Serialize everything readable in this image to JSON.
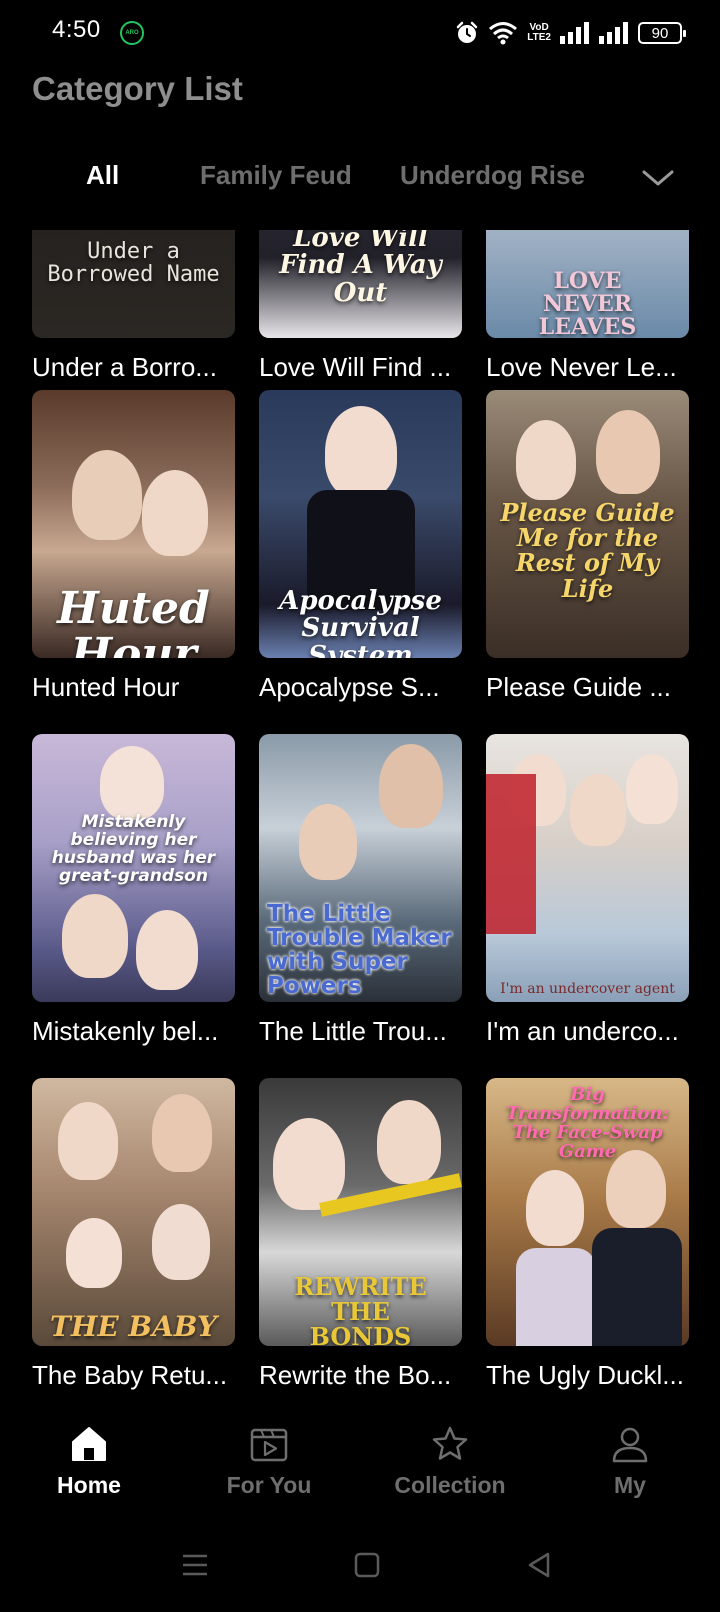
{
  "status_bar": {
    "time": "4:50",
    "aro_badge": "ARO",
    "volte_top": "VoD",
    "volte_bottom": "LTE2",
    "battery": "90"
  },
  "header": {
    "title": "Category List"
  },
  "tabs": [
    {
      "label": "All",
      "active": true
    },
    {
      "label": "Family Feud",
      "active": false
    },
    {
      "label": "Underdog Rise",
      "active": false
    }
  ],
  "dramas": [
    {
      "title": "Under a Borro...",
      "poster_text": "Under a\nBorrowed Name"
    },
    {
      "title": "Love Will Find ...",
      "poster_text": "Love Will Find A Way Out"
    },
    {
      "title": "Love Never Le...",
      "poster_text": "LOVE NEVER LEAVES"
    },
    {
      "title": "Hunted Hour",
      "poster_text": "Huted Hour"
    },
    {
      "title": "Apocalypse S...",
      "poster_text": "Apocalypse Survival System"
    },
    {
      "title": "Please Guide ...",
      "poster_text": "Please Guide Me for the Rest of My Life"
    },
    {
      "title": "Mistakenly bel...",
      "poster_text": "Mistakenly believing her husband was her great-grandson"
    },
    {
      "title": "The Little Trou...",
      "poster_text": "The Little Trouble Maker with Super Powers"
    },
    {
      "title": "I'm an underco...",
      "poster_text": "I'm an undercover agent"
    },
    {
      "title": "The Baby Retu...",
      "poster_text": "THE BABY"
    },
    {
      "title": "Rewrite the Bo...",
      "poster_text": "REWRITE THE BONDS"
    },
    {
      "title": "The Ugly Duckl...",
      "poster_text": "Big Transformation: The Face-Swap Game"
    }
  ],
  "bottom_nav": [
    {
      "label": "Home",
      "icon": "home-icon",
      "active": true
    },
    {
      "label": "For You",
      "icon": "play-card-icon",
      "active": false
    },
    {
      "label": "Collection",
      "icon": "star-icon",
      "active": false
    },
    {
      "label": "My",
      "icon": "person-icon",
      "active": false
    }
  ],
  "colors": {
    "background": "#000000",
    "inactive": "#6e6e6e",
    "title_gray": "#8e8e8e",
    "active": "#ffffff"
  }
}
